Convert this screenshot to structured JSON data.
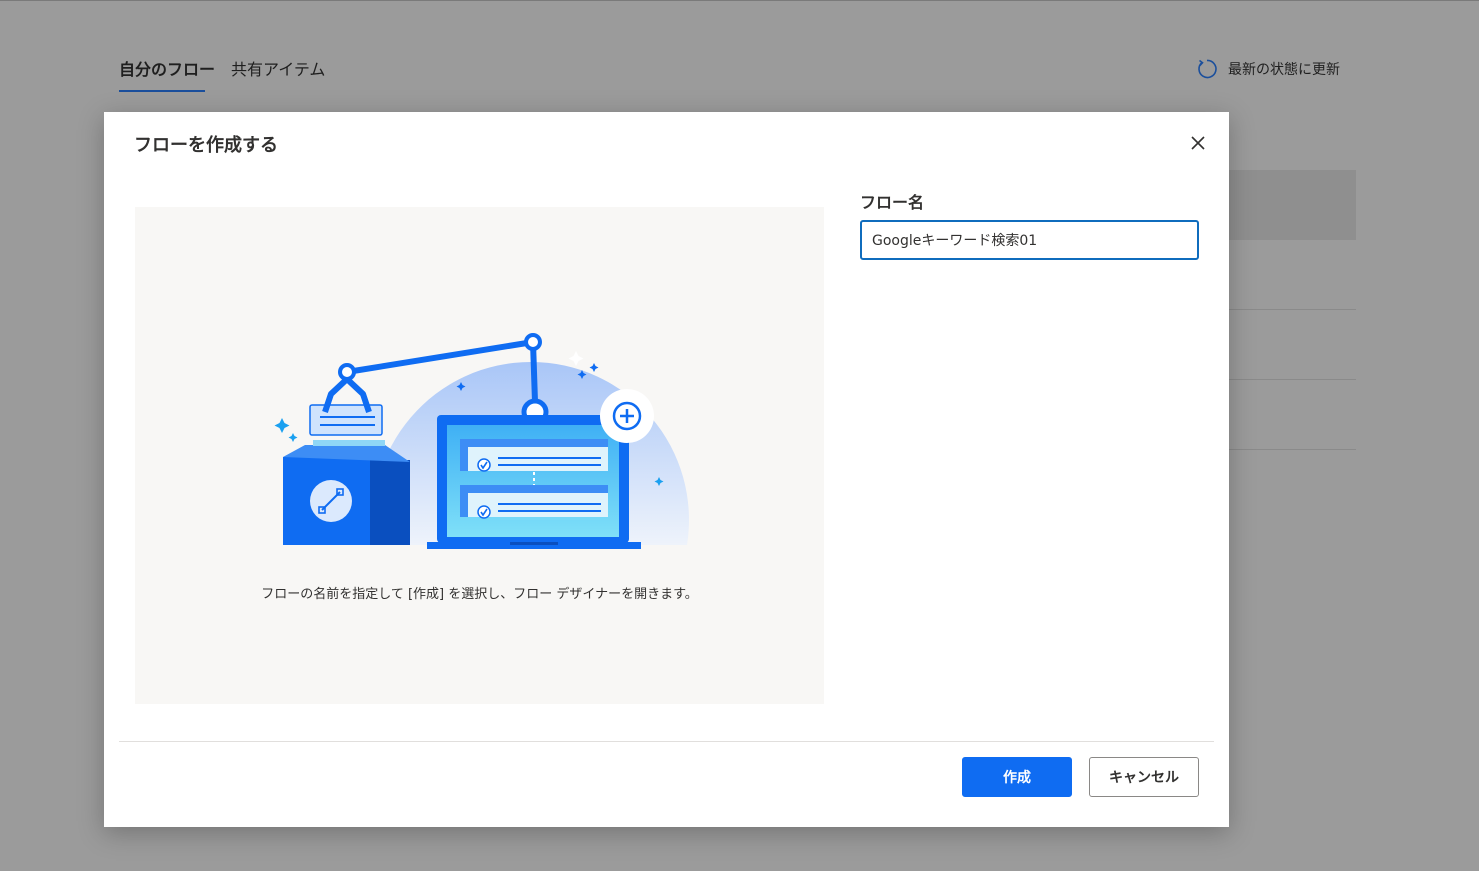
{
  "background": {
    "tabs": [
      {
        "label": "自分のフロー",
        "active": true
      },
      {
        "label": "共有アイテム",
        "active": false
      }
    ],
    "refresh_label": "最新の状態に更新",
    "refresh_icon": "refresh-icon"
  },
  "dialog": {
    "title": "フローを作成する",
    "close_icon": "close-icon",
    "illustration": "flow-designer-illustration",
    "caption": "フローの名前を指定して [作成] を選択し、フロー デザイナーを開きます。",
    "field_label": "フロー名",
    "field_value": "Googleキーワード検索01",
    "create_label": "作成",
    "cancel_label": "キャンセル"
  },
  "colors": {
    "accent": "#0f6cf2",
    "overlay": "#9b9b9b",
    "panel": "#f8f7f5"
  }
}
